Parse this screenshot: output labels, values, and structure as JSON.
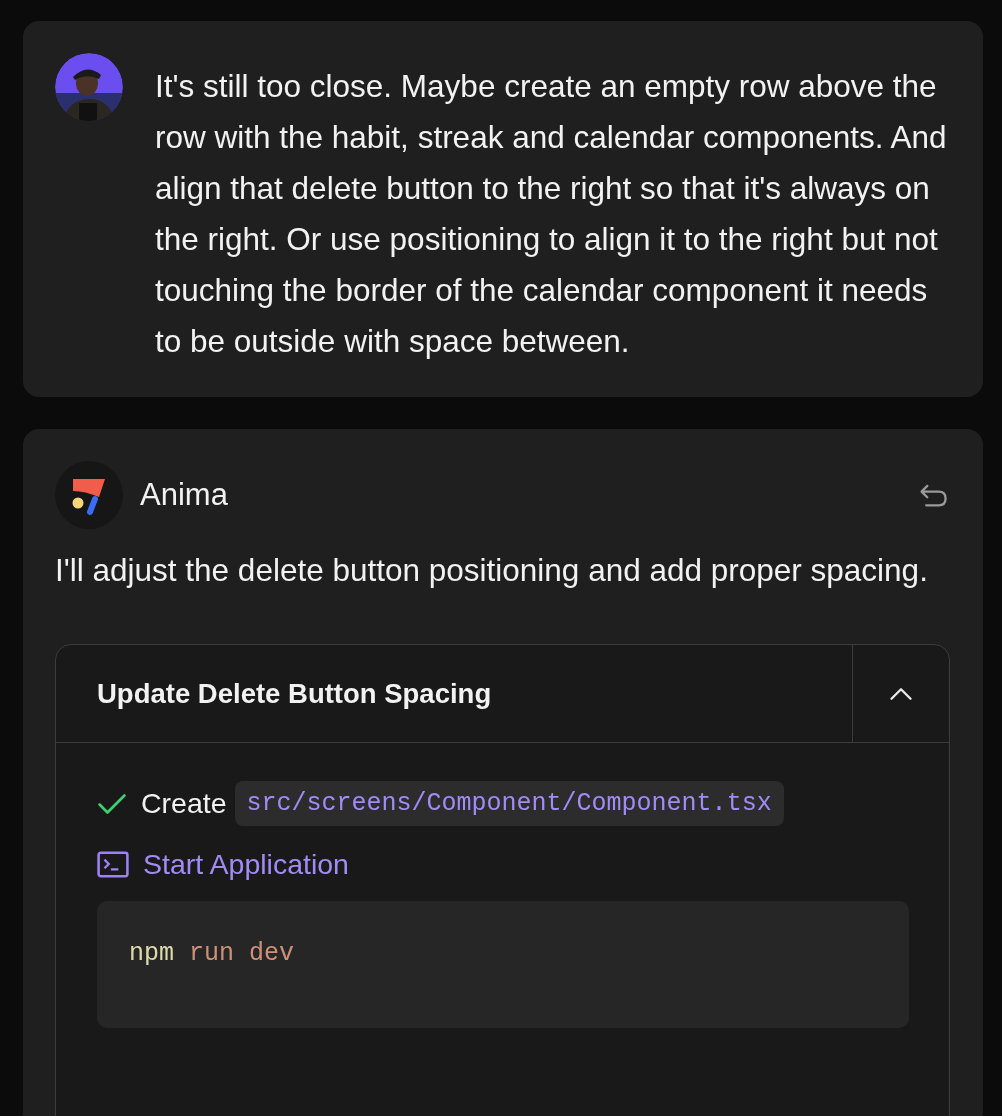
{
  "user_message": {
    "text": "It's still too close. Maybe create an empty row above the row with the habit, streak and calendar components. And align that delete button to the right so that it's always on the right. Or use positioning to align it to the right but not touching the border of the calendar component it needs to be outside with space between."
  },
  "assistant_message": {
    "name": "Anima",
    "text": "I'll adjust the delete button positioning and add proper spacing.",
    "task": {
      "title": "Update Delete Button Spacing",
      "expanded": true,
      "steps": [
        {
          "kind": "file",
          "done": true,
          "verb": "Create",
          "path": "src/screens/Component/Component.tsx"
        },
        {
          "kind": "command",
          "label": "Start Application",
          "tokens": [
            {
              "text": "npm",
              "color": "#dcdcaa"
            },
            {
              "text": "run",
              "color": "#ce9178"
            },
            {
              "text": "dev",
              "color": "#ce9178"
            }
          ]
        }
      ]
    }
  }
}
